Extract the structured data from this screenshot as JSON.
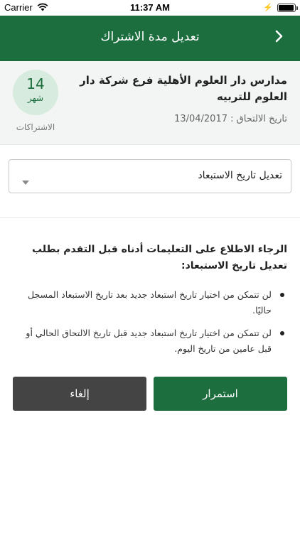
{
  "status_bar": {
    "carrier": "Carrier",
    "time": "11:37 AM"
  },
  "nav": {
    "title": "تعديل مدة الاشتراك",
    "back_icon": "chevron-right-icon"
  },
  "info": {
    "school_name": "مدارس دار العلوم الأهلية فرع شركة دار العلوم للتربيه",
    "join_date": "تاريخ الالتحاق : 13/04/2017",
    "subscription_count": "14",
    "subscription_unit": "شهر",
    "subscription_caption": "الاشتراكات"
  },
  "dropdown": {
    "selected": "تعديل تاريخ الاستبعاد"
  },
  "instructions": {
    "heading": "الرجاء الاطلاع على التعليمات أدناه قبل التقدم بطلب تعديل تاريخ الاستبعاد:",
    "items": [
      "لن تتمكن من اختيار تاريخ استبعاد جديد بعد تاريخ الاستبعاد المسجل حاليًا.",
      "لن تتمكن من اختيار تاريخ استبعاد جديد قبل تاريخ الالتحاق الحالي أو قبل عامين من تاريخ اليوم."
    ]
  },
  "buttons": {
    "continue_label": "استمرار",
    "cancel_label": "إلغاء"
  },
  "colors": {
    "primary": "#1c6e3f",
    "cancel": "#444444",
    "card_bg": "#f2f5f3",
    "circle_bg": "#d7ecde"
  }
}
